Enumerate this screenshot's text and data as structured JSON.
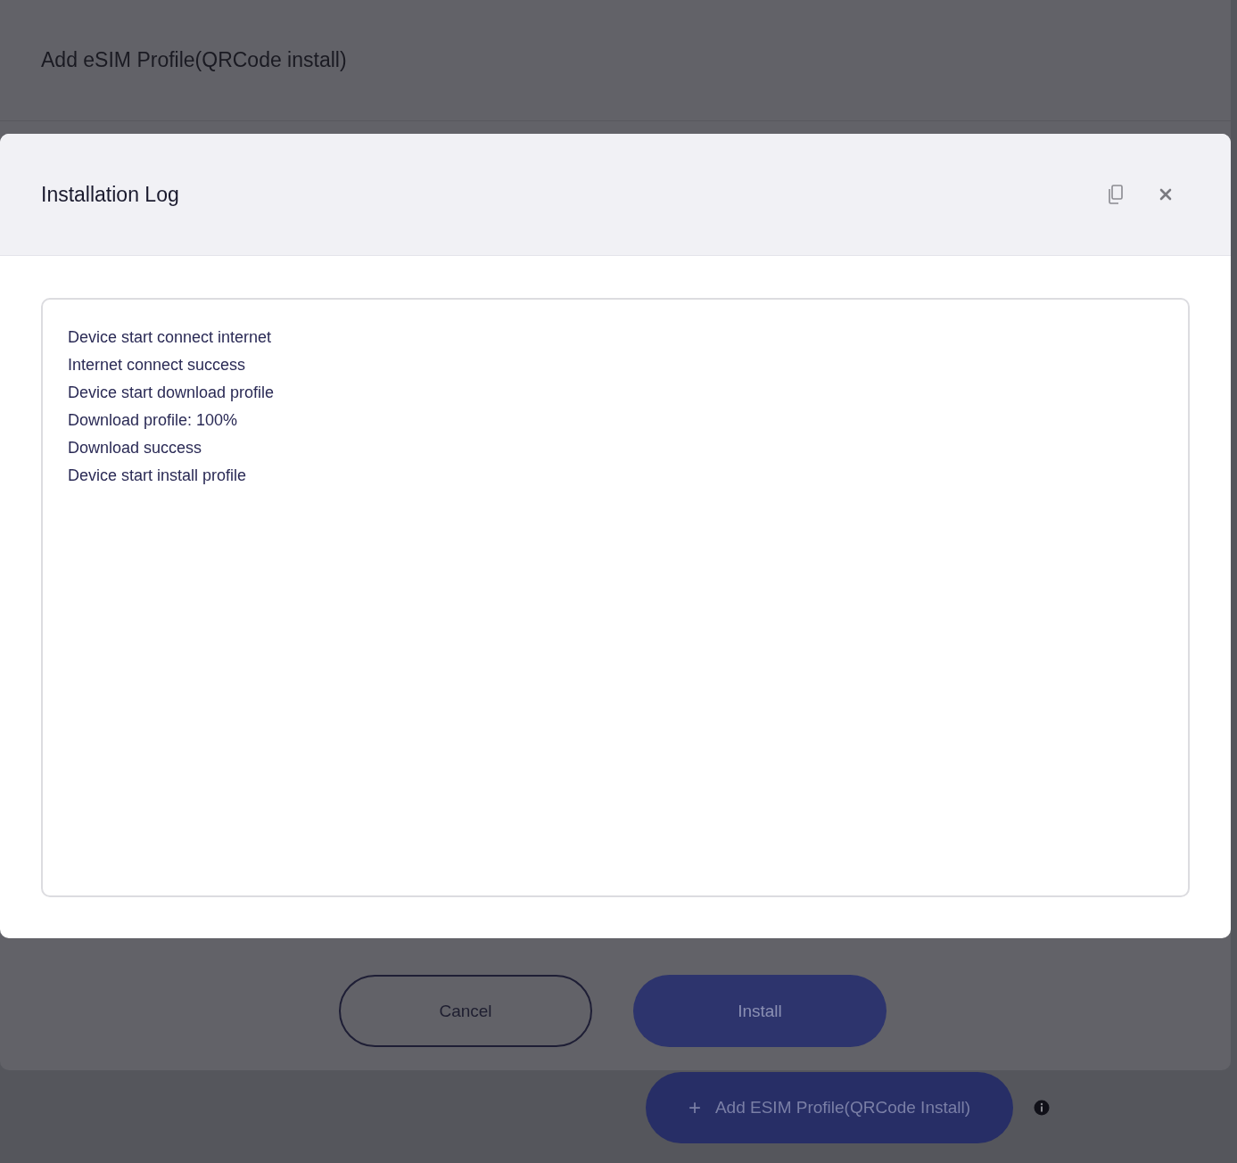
{
  "background_dialog": {
    "title": "Add eSIM Profile(QRCode install)",
    "buttons": [
      {
        "label": "Cancel",
        "kind": "secondary"
      },
      {
        "label": "Install",
        "kind": "primary"
      }
    ]
  },
  "add_button": {
    "icon": "+",
    "label": "Add ESIM Profile(QRCode Install)"
  },
  "modal": {
    "title": "Installation Log",
    "log_lines": [
      "Device start connect internet",
      "Internet connect success",
      "Device start download profile",
      "Download profile: 100%",
      "Download success",
      "Device start install profile"
    ]
  }
}
